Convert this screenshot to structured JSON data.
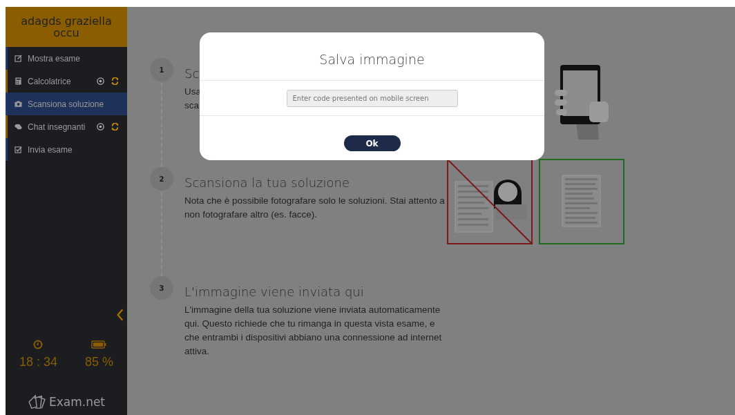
{
  "sidebar": {
    "user_name": "adagds graziella occu",
    "items": [
      {
        "label": "Mostra esame",
        "selected": false,
        "tools": false,
        "color": "#1f3a6e"
      },
      {
        "label": "Calcolatrice",
        "selected": false,
        "tools": true,
        "color": "#8a5d00"
      },
      {
        "label": "Scansiona soluzione",
        "selected": true,
        "tools": false,
        "color": "#1f3a6e"
      },
      {
        "label": "Chat insegnanti",
        "selected": false,
        "tools": true,
        "color": "#8a5d00"
      },
      {
        "label": "Invia esame",
        "selected": false,
        "tools": false,
        "color": "#1f3a6e"
      }
    ],
    "time": "18 : 34",
    "battery": "85 %",
    "logo": "Exam.net"
  },
  "steps": [
    {
      "number": "1",
      "title": "Sc",
      "lines": [
        "Usa",
        "sca"
      ]
    },
    {
      "number": "2",
      "title": "Scansiona la tua soluzione",
      "lines": [
        "Nota che è possibile fotografare solo le soluzioni. Stai attento a non fotografare altro (es. facce)."
      ]
    },
    {
      "number": "3",
      "title": "L'immagine viene inviata qui",
      "lines": [
        "L'immagine della tua soluzione viene inviata automaticamente qui. Questo richiede che tu rimanga in questa vista esame, e che entrambi i dispositivi abbiano una connessione ad internet attiva."
      ]
    }
  ],
  "dialog": {
    "title": "Salva immagine",
    "placeholder": "Enter code presented on mobile screen",
    "button": "Ok"
  }
}
